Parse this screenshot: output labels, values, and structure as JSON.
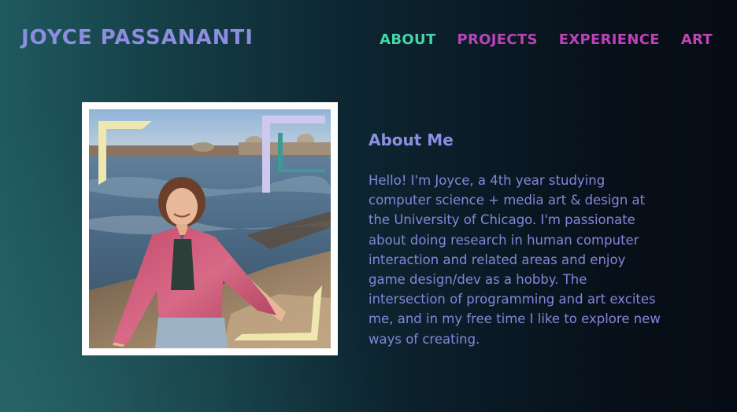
{
  "header": {
    "title": "JOYCE PASSANANTI"
  },
  "nav": {
    "items": [
      {
        "label": "ABOUT",
        "color": "#46d6a6"
      },
      {
        "label": "PROJECTS",
        "color": "#bb43b8"
      },
      {
        "label": "EXPERIENCE",
        "color": "#bd42b8"
      },
      {
        "label": "ART",
        "color": "#c044b5"
      }
    ]
  },
  "about": {
    "heading": "About Me",
    "body": "Hello! I'm Joyce, a 4th year studying computer science + media art & design at the University of Chicago. I'm passionate about doing research in human computer interaction and related areas and enjoy game design/dev as a hobby. The intersection of programming and art excites me, and in my free time I like to explore new ways of creating."
  },
  "colors": {
    "title": "#8c8de0",
    "heading": "#8d8fe2",
    "body_text": "#8486dc",
    "background_left": "#1f5a60",
    "background_right": "#060c15",
    "frame": "#ffffff",
    "corner_yellow": "#eee8b0",
    "corner_lavender": "#cfc8ee",
    "corner_teal": "#3f9a96"
  },
  "photo": {
    "icon": "portrait-photo"
  }
}
